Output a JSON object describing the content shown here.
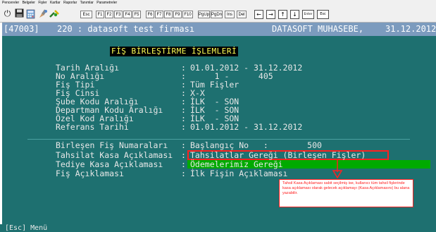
{
  "menubar": [
    "Pencereler",
    "Belgeler",
    "Fişler",
    "Kartlar",
    "Raporlar",
    "Tanımlar",
    "Parametreler"
  ],
  "toolbar": {
    "icons": [
      "power-icon",
      "disk-icon",
      "calculator-icon",
      "paint-icon",
      "tools-icon"
    ],
    "keys": [
      "Esc",
      "F1",
      "F2",
      "F3",
      "F4",
      "F5",
      "F6",
      "F7",
      "F8",
      "F9",
      "F10",
      "PgUp",
      "PgDn",
      "Ins",
      "Del"
    ],
    "nav_boxes": [
      "←",
      "→",
      "↑",
      "↓",
      "Enter",
      "Esc"
    ]
  },
  "titlebar": {
    "company_code": "[47003]",
    "company_name": "220 : datasoft test firması",
    "product": "DATASOFT MUHASEBE,",
    "date": "31.12.2012"
  },
  "heading": "FİŞ BİRLEŞTİRME İŞLEMLERİ",
  "fields": [
    {
      "label": "Tarih Aralığı",
      "value": "01.01.2012 - 31.12.2012"
    },
    {
      "label": "No Aralığı",
      "value": "     1 -      405"
    },
    {
      "label": "Fiş Tipi",
      "value": "Tüm Fişler"
    },
    {
      "label": "Fiş Cinsi",
      "value": "X-X"
    },
    {
      "label": "Şube Kodu Aralığı",
      "value": "İLK  - SON"
    },
    {
      "label": "Departman Kodu Aralığı",
      "value": "İLK  - SON"
    },
    {
      "label": "Özel Kod Aralığı",
      "value": "İLK  - SON"
    },
    {
      "label": "Referans Tarihi",
      "value": "01.01.2012 - 31.12.2012"
    }
  ],
  "fields2": [
    {
      "label": "Birleşen Fiş Numaraları",
      "value": "Başlangıç No   :        500"
    },
    {
      "label": "Tahsilat Kasa Açıklaması",
      "value": "Tahsilatlar Gereği (Birleşen Fişler)"
    },
    {
      "label": "Tediye Kasa Açıklaması",
      "value": "Ödemelerimiz Gereği"
    },
    {
      "label": "Fiş Açıklaması",
      "value": "İlk Fişin Açıklaması"
    }
  ],
  "tooltip": "Tahsil Kasa Açıklaması sabit seçilmiş ise, kullanıcı tüm tahsil fişlerinde kasa açıklaması olarak gelecek açıklamayı (Kasa Açıklamasını) bu alana yazabilir.",
  "status": "[Esc] Menü",
  "colors": {
    "screen": "#1e7070",
    "titlebar": "#7c9bbe",
    "highlight": "#00aa00",
    "heading": "#ffff55",
    "annotation": "#ff2020"
  }
}
